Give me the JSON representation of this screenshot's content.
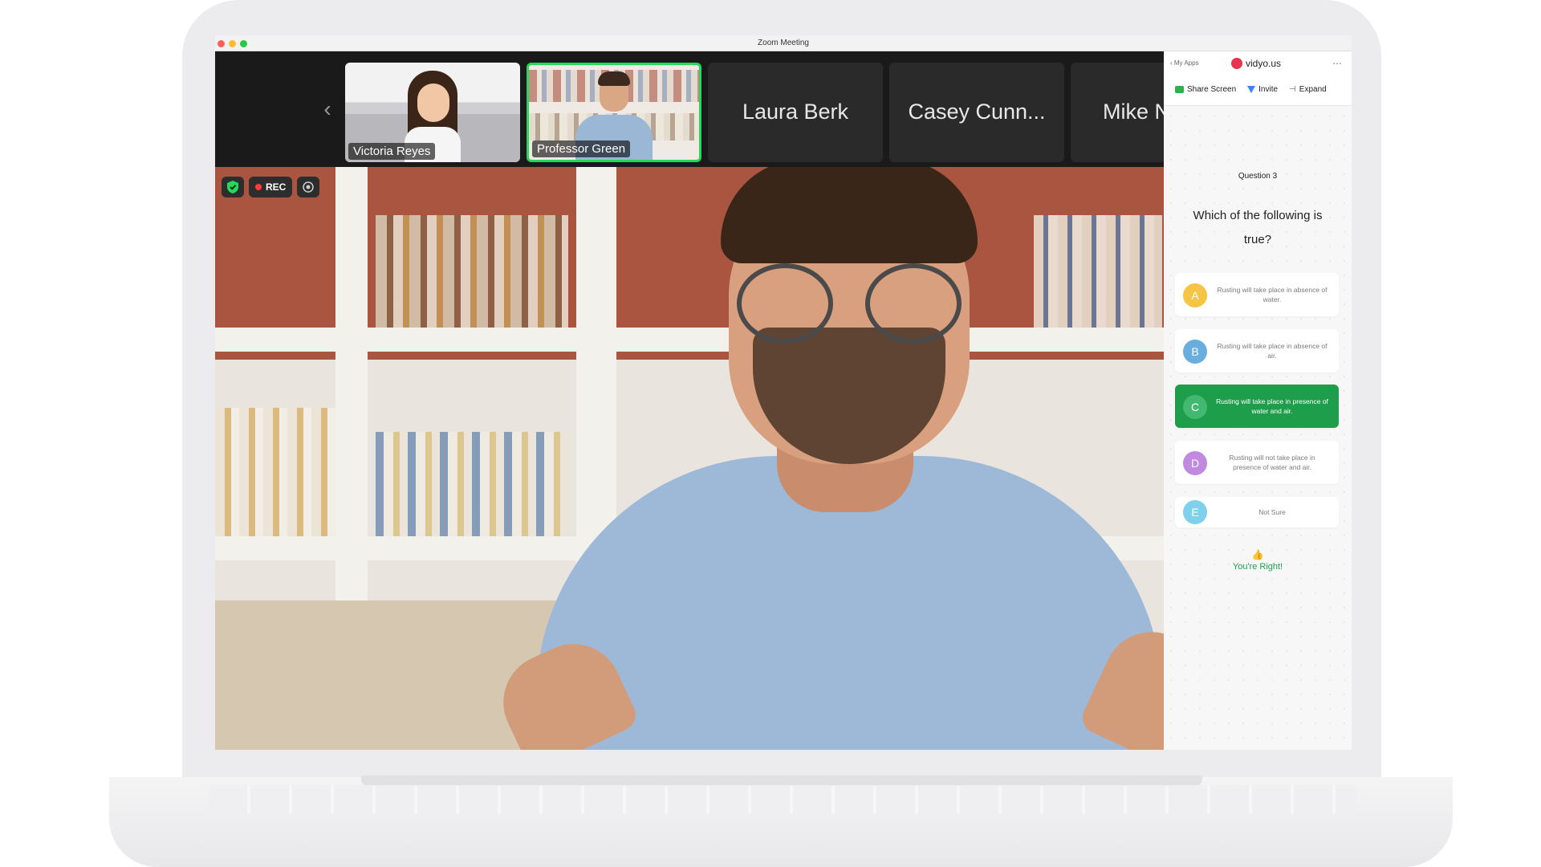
{
  "window": {
    "title": "Zoom Meeting"
  },
  "strip": {
    "prev_icon": "chevron-left-icon",
    "participants": [
      {
        "name": "Victoria Reyes",
        "has_video": true
      },
      {
        "name": "Professor Green",
        "has_video": true,
        "active_speaker": true
      },
      {
        "name": "Laura Berk",
        "has_video": false
      },
      {
        "name": "Casey Cunn...",
        "has_video": false
      },
      {
        "name": "Mike N",
        "has_video": false
      }
    ]
  },
  "main_video": {
    "badges": {
      "shield_icon": "shield-check-icon",
      "rec_label": "REC",
      "camera_icon": "record-settings-icon"
    }
  },
  "panel": {
    "back_label": "‹ My Apps",
    "brand": "vidyo.us",
    "more_icon": "⋯",
    "actions": {
      "share": "Share Screen",
      "invite": "Invite",
      "expand": "Expand",
      "expand_icon": "⊣"
    },
    "question_number": "Question 3",
    "question": "Which of the following is true?",
    "options": [
      {
        "letter": "A",
        "text": "Rusting will take place in absence of water.",
        "color": "#f6c544"
      },
      {
        "letter": "B",
        "text": "Rusting will take place in absence of air.",
        "color": "#6aaee0"
      },
      {
        "letter": "C",
        "text": "Rusting will take place in presence of water and air.",
        "color": "#43b871",
        "selected": true
      },
      {
        "letter": "D",
        "text": "Rusting will not take place in presence of water and air.",
        "color": "#c08ae0"
      },
      {
        "letter": "E",
        "text": "Not Sure",
        "color": "#7fd0ea"
      }
    ],
    "feedback_emoji": "👍",
    "feedback": "You're Right!"
  },
  "colors": {
    "accent_green": "#1e9e4a",
    "active_border": "#23d959",
    "rec_red": "#ff3b3b"
  }
}
